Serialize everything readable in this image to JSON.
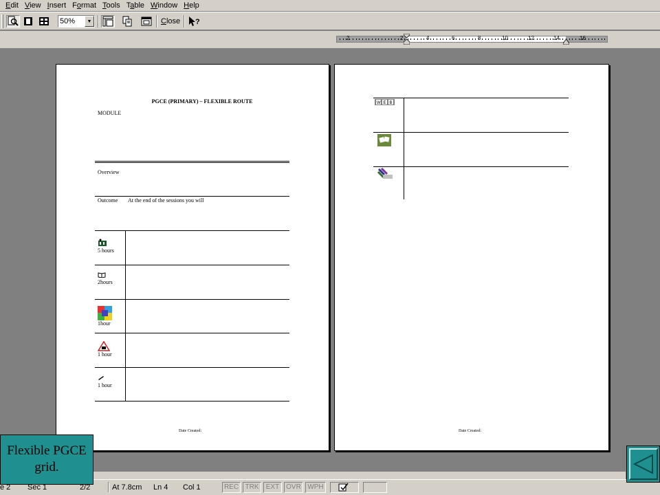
{
  "menu": [
    "Edit",
    "View",
    "Insert",
    "Format",
    "Tools",
    "Table",
    "Window",
    "Help"
  ],
  "menu_underline": [
    "E",
    "V",
    "I",
    "o",
    "T",
    "a",
    "W",
    "H"
  ],
  "toolbar": {
    "zoom_value": "50%",
    "close_label": "Close",
    "close_underline": "C"
  },
  "ruler": {
    "numbers": [
      "2",
      "2",
      "4",
      "6",
      "8",
      "10",
      "12",
      "14",
      "16"
    ]
  },
  "page1": {
    "title": "PGCE (PRIMARY) – FLEXIBLE ROUTE",
    "module": "MODULE",
    "overview": "Overview",
    "outcome": "Outcome",
    "outcome_text": "At the end of the sessions you will",
    "rows": [
      {
        "icon": "lecture-icon",
        "time": "5 hours"
      },
      {
        "icon": "book-icon",
        "time": "2hours"
      },
      {
        "icon": "colorful-tile-icon",
        "time": "1hour"
      },
      {
        "icon": "warning-triangle-icon",
        "time": "1 hour"
      },
      {
        "icon": "pen-icon",
        "time": "1 hour"
      }
    ],
    "footer": "Date Created:"
  },
  "page2": {
    "rows": [
      {
        "icon": "web-icon"
      },
      {
        "icon": "dice-icon"
      },
      {
        "icon": "pencils-icon"
      }
    ],
    "footer": "Date Created:"
  },
  "status": {
    "page": "e 2",
    "sec": "Sec  1",
    "pages": "2/2",
    "at": "At  7.8cm",
    "ln": "Ln  4",
    "col": "Col  1",
    "modes": [
      "REC",
      "TRK",
      "EXT",
      "OVR",
      "WPH"
    ]
  },
  "overlay": {
    "label": "Flexible PGCE grid."
  },
  "colors": {
    "chrome": "#d4d0c8",
    "workspace": "#808080",
    "overlay_teal": "#1f8f8f"
  }
}
